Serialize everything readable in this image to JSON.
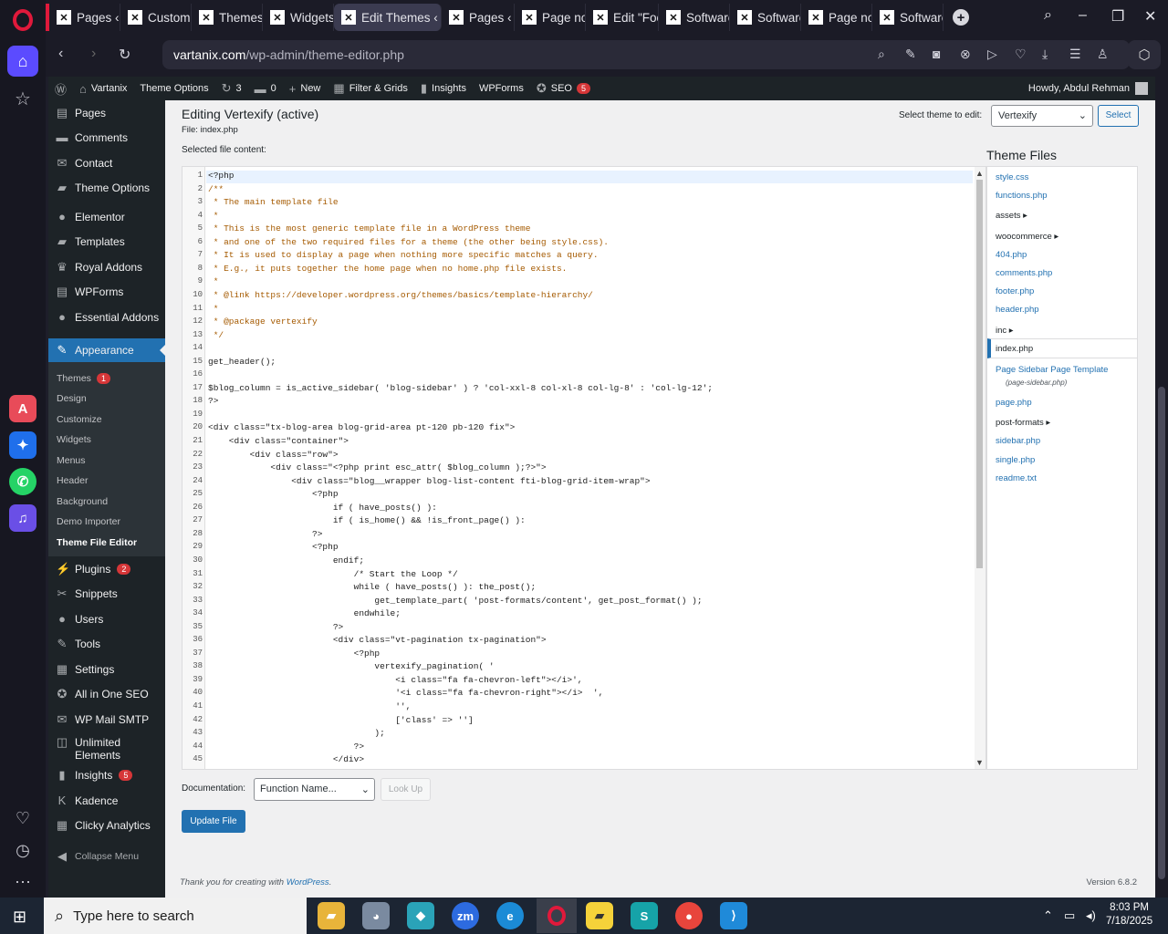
{
  "browser": {
    "tabs": [
      {
        "title": "Pages ‹ Va",
        "active": false
      },
      {
        "title": "Customiz",
        "active": false
      },
      {
        "title": "Themes ‹",
        "active": false
      },
      {
        "title": "Widgets ‹",
        "active": false
      },
      {
        "title": "Edit Themes ‹ Va",
        "active": true
      },
      {
        "title": "Pages ‹ Va",
        "active": false
      },
      {
        "title": "Page not",
        "active": false
      },
      {
        "title": "Edit \"Foot",
        "active": false
      },
      {
        "title": "Software",
        "active": false
      },
      {
        "title": "Software",
        "active": false
      },
      {
        "title": "Page not",
        "active": false
      },
      {
        "title": "Software",
        "active": false
      }
    ],
    "url_domain": "vartanix.com",
    "url_path": "/wp-admin/theme-editor.php"
  },
  "adminbar": {
    "site": "Vartanix",
    "theme_options": "Theme Options",
    "updates": "3",
    "comments": "0",
    "new": "New",
    "filter": "Filter & Grids",
    "insights": "Insights",
    "wpforms": "WPForms",
    "seo": "SEO",
    "seo_count": "5",
    "howdy": "Howdy, Abdul Rehman"
  },
  "menu": {
    "top": [
      {
        "label": "Pages",
        "icon": "pages-icon",
        "glyph": "▤"
      },
      {
        "label": "Comments",
        "icon": "comments-icon",
        "glyph": "▬"
      },
      {
        "label": "Contact",
        "icon": "mail-icon",
        "glyph": "✉"
      },
      {
        "label": "Theme Options",
        "icon": "folder-icon",
        "glyph": "▰"
      }
    ],
    "mid": [
      {
        "label": "Elementor",
        "icon": "elementor-icon",
        "glyph": "●"
      },
      {
        "label": "Templates",
        "icon": "folder-icon",
        "glyph": "▰"
      },
      {
        "label": "Royal Addons",
        "icon": "crown-icon",
        "glyph": "♛"
      },
      {
        "label": "WPForms",
        "icon": "forms-icon",
        "glyph": "▤"
      },
      {
        "label": "Essential Addons",
        "icon": "ea-icon",
        "glyph": "●"
      }
    ],
    "appearance": "Appearance",
    "sub": [
      {
        "label": "Themes",
        "badge": "1"
      },
      {
        "label": "Design"
      },
      {
        "label": "Customize"
      },
      {
        "label": "Widgets"
      },
      {
        "label": "Menus"
      },
      {
        "label": "Header"
      },
      {
        "label": "Background"
      },
      {
        "label": "Demo Importer"
      },
      {
        "label": "Theme File Editor",
        "current": true
      }
    ],
    "bottom": [
      {
        "label": "Plugins",
        "icon": "plug-icon",
        "glyph": "⚡",
        "badge": "2"
      },
      {
        "label": "Snippets",
        "icon": "scissors-icon",
        "glyph": "✂"
      },
      {
        "label": "Users",
        "icon": "user-icon",
        "glyph": "●"
      },
      {
        "label": "Tools",
        "icon": "wrench-icon",
        "glyph": "✎"
      },
      {
        "label": "Settings",
        "icon": "settings-icon",
        "glyph": "▦"
      },
      {
        "label": "All in One SEO",
        "icon": "aioseo-icon",
        "glyph": "✪"
      },
      {
        "label": "WP Mail SMTP",
        "icon": "mail-icon",
        "glyph": "✉"
      }
    ],
    "unlimited_1": "Unlimited",
    "unlimited_2": "Elements",
    "bottom2": [
      {
        "label": "Insights",
        "icon": "chart-icon",
        "glyph": "▮",
        "badge": "5"
      },
      {
        "label": "Kadence",
        "icon": "kadence-icon",
        "glyph": "K"
      },
      {
        "label": "Clicky Analytics",
        "icon": "clicky-icon",
        "glyph": "▦"
      }
    ],
    "collapse": "Collapse Menu"
  },
  "editor": {
    "heading": "Editing Vertexify (active)",
    "file": "File: index.php",
    "selected_label": "Selected file content:",
    "select_theme_label": "Select theme to edit:",
    "select_theme_value": "Vertexify",
    "select_button": "Select",
    "code": [
      "<?php",
      "/**",
      " * The main template file",
      " *",
      " * This is the most generic template file in a WordPress theme",
      " * and one of the two required files for a theme (the other being style.css).",
      " * It is used to display a page when nothing more specific matches a query.",
      " * E.g., it puts together the home page when no home.php file exists.",
      " *",
      " * @link https://developer.wordpress.org/themes/basics/template-hierarchy/",
      " *",
      " * @package vertexify",
      " */",
      "",
      "get_header();",
      "",
      "$blog_column = is_active_sidebar( 'blog-sidebar' ) ? 'col-xxl-8 col-xl-8 col-lg-8' : 'col-lg-12';",
      "?>",
      "",
      "<div class=\"tx-blog-area blog-grid-area pt-120 pb-120 fix\">",
      "    <div class=\"container\">",
      "        <div class=\"row\">",
      "            <div class=\"<?php print esc_attr( $blog_column );?>\">",
      "                <div class=\"blog__wrapper blog-list-content fti-blog-grid-item-wrap\">",
      "                    <?php",
      "                        if ( have_posts() ):",
      "                        if ( is_home() && !is_front_page() ):",
      "                    ?>",
      "                    <?php",
      "                        endif;",
      "                            /* Start the Loop */",
      "                            while ( have_posts() ): the_post();",
      "                                get_template_part( 'post-formats/content', get_post_format() );",
      "                            endwhile;",
      "                        ?>",
      "                        <div class=\"vt-pagination tx-pagination\">",
      "                            <?php",
      "                                vertexify_pagination( '",
      "                                    <i class=\"fa fa-chevron-left\"></i>',",
      "                                    '<i class=\"fa fa-chevron-right\"></i>  ',",
      "                                    '',",
      "                                    ['class' => '']",
      "                                );",
      "                            ?>",
      "                        </div>"
    ],
    "theme_files_heading": "Theme Files",
    "files": [
      {
        "name": "style.css"
      },
      {
        "name": "functions.php"
      },
      {
        "name": "assets ▸",
        "dir": true
      },
      {
        "name": "woocommerce ▸",
        "dir": true
      },
      {
        "name": "404.php"
      },
      {
        "name": "comments.php"
      },
      {
        "name": "footer.php"
      },
      {
        "name": "header.php"
      },
      {
        "name": "inc ▸",
        "dir": true
      },
      {
        "name": "index.php",
        "current": true
      },
      {
        "name": "Page Sidebar Page Template",
        "sub": "(page-sidebar.php)"
      },
      {
        "name": "page.php"
      },
      {
        "name": "post-formats ▸",
        "dir": true
      },
      {
        "name": "sidebar.php"
      },
      {
        "name": "single.php"
      },
      {
        "name": "readme.txt"
      }
    ],
    "doc_label": "Documentation:",
    "doc_value": "Function Name...",
    "lookup": "Look Up",
    "update": "Update File",
    "footer_text": "Thank you for creating with",
    "footer_link": "WordPress",
    "version": "Version 6.8.2"
  },
  "taskbar": {
    "search_placeholder": "Type here to search",
    "time": "8:03 PM",
    "date": "7/18/2025"
  }
}
